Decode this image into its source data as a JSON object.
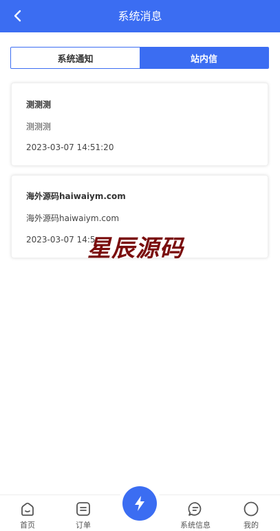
{
  "header": {
    "title": "系统消息"
  },
  "tabs": [
    {
      "label": "系统通知",
      "active": false
    },
    {
      "label": "站内信",
      "active": true
    }
  ],
  "messages": [
    {
      "title": "测测测",
      "body": "测测测",
      "time": "2023-03-07 14:51:20"
    },
    {
      "title": "海外源码haiwaiym.com",
      "body": "海外源码haiwaiym.com",
      "time": "2023-03-07 14:5"
    }
  ],
  "watermark": "星辰源码",
  "tabbar": {
    "items": [
      {
        "label": "首页",
        "icon": "home-icon"
      },
      {
        "label": "订单",
        "icon": "order-icon"
      },
      {
        "label": "系统信息",
        "icon": "message-icon"
      },
      {
        "label": "我的",
        "icon": "profile-icon"
      }
    ],
    "center_icon": "lightning-icon"
  },
  "colors": {
    "primary": "#3b6df2",
    "watermark": "#7a0d0d"
  }
}
